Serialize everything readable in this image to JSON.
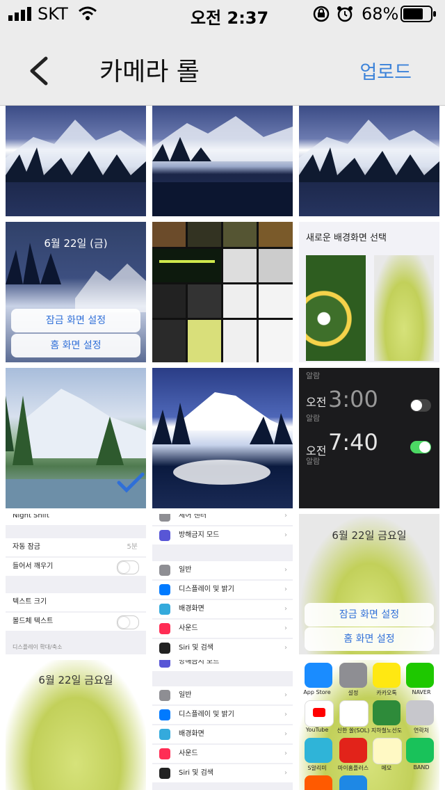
{
  "status_bar": {
    "carrier": "SKT",
    "time": "오전 2:37",
    "battery": "68%"
  },
  "nav": {
    "title": "카메라 롤",
    "upload_label": "업로드"
  },
  "photos": [
    {
      "label": "mountain-snow-1"
    },
    {
      "label": "mountain-lake-1"
    },
    {
      "label": "mountain-snow-2"
    },
    {
      "date": "6월 22일 (금)",
      "btn_lock": "잠금 화면 설정",
      "btn_home": "홈 화면 설정"
    },
    {
      "label": "collage"
    },
    {
      "header": "새로운 배경화면 선택"
    },
    {
      "label": "mountain-meadow"
    },
    {
      "label": "mountain-reflection"
    },
    {
      "alarm_top": "알람",
      "alarm1_prefix": "오전",
      "alarm1_time": "3:00",
      "alarm1_label": "알람",
      "alarm2_prefix": "오전",
      "alarm2_time": "7:40",
      "alarm2_label": "알람"
    },
    {
      "rows": [
        "Night Shift",
        "자동 잠금",
        "들어서 깨우기",
        "텍스트 크기",
        "볼드체 텍스트",
        "디스플레이 확대/축소"
      ],
      "auto_lock_value": "5분"
    },
    {
      "rows": [
        "제어 센터",
        "방해금지 모드",
        "일반",
        "디스플레이 및 밝기",
        "배경화면",
        "사운드",
        "Siri 및 검색"
      ]
    },
    {
      "date": "6월 22일 금요일",
      "btn_lock": "잠금 화면 설정",
      "btn_home": "홈 화면 설정"
    },
    {
      "date": "6월 22일 금요일"
    },
    {
      "rows": [
        "방해금지 모드",
        "일반",
        "디스플레이 및 밝기",
        "배경화면",
        "사운드",
        "Siri 및 검색"
      ]
    },
    {
      "apps": [
        "App Store",
        "설정",
        "카카오톡",
        "NAVER",
        "YouTube",
        "신한 쏠(SOL)",
        "지하철노선도",
        "연락처",
        "S알리미",
        "마이홈플러스",
        "메모",
        "BAND"
      ]
    }
  ]
}
